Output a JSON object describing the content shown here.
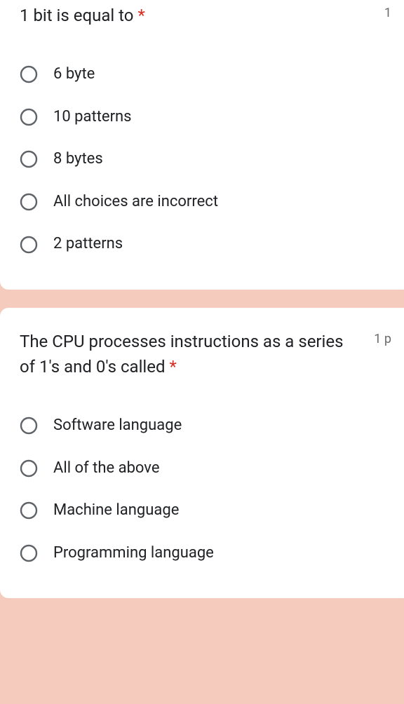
{
  "questions": [
    {
      "title": "1 bit is equal to",
      "required_mark": "*",
      "points": "1",
      "options": [
        {
          "label": "6 byte"
        },
        {
          "label": "10 patterns"
        },
        {
          "label": "8 bytes"
        },
        {
          "label": "All choices are incorrect"
        },
        {
          "label": "2 patterns"
        }
      ]
    },
    {
      "title": "The CPU processes instructions as a series of 1's and 0's called",
      "required_mark": "*",
      "points": "1 p",
      "options": [
        {
          "label": "Software language"
        },
        {
          "label": "All of the above"
        },
        {
          "label": "Machine language"
        },
        {
          "label": "Programming language"
        }
      ]
    }
  ]
}
